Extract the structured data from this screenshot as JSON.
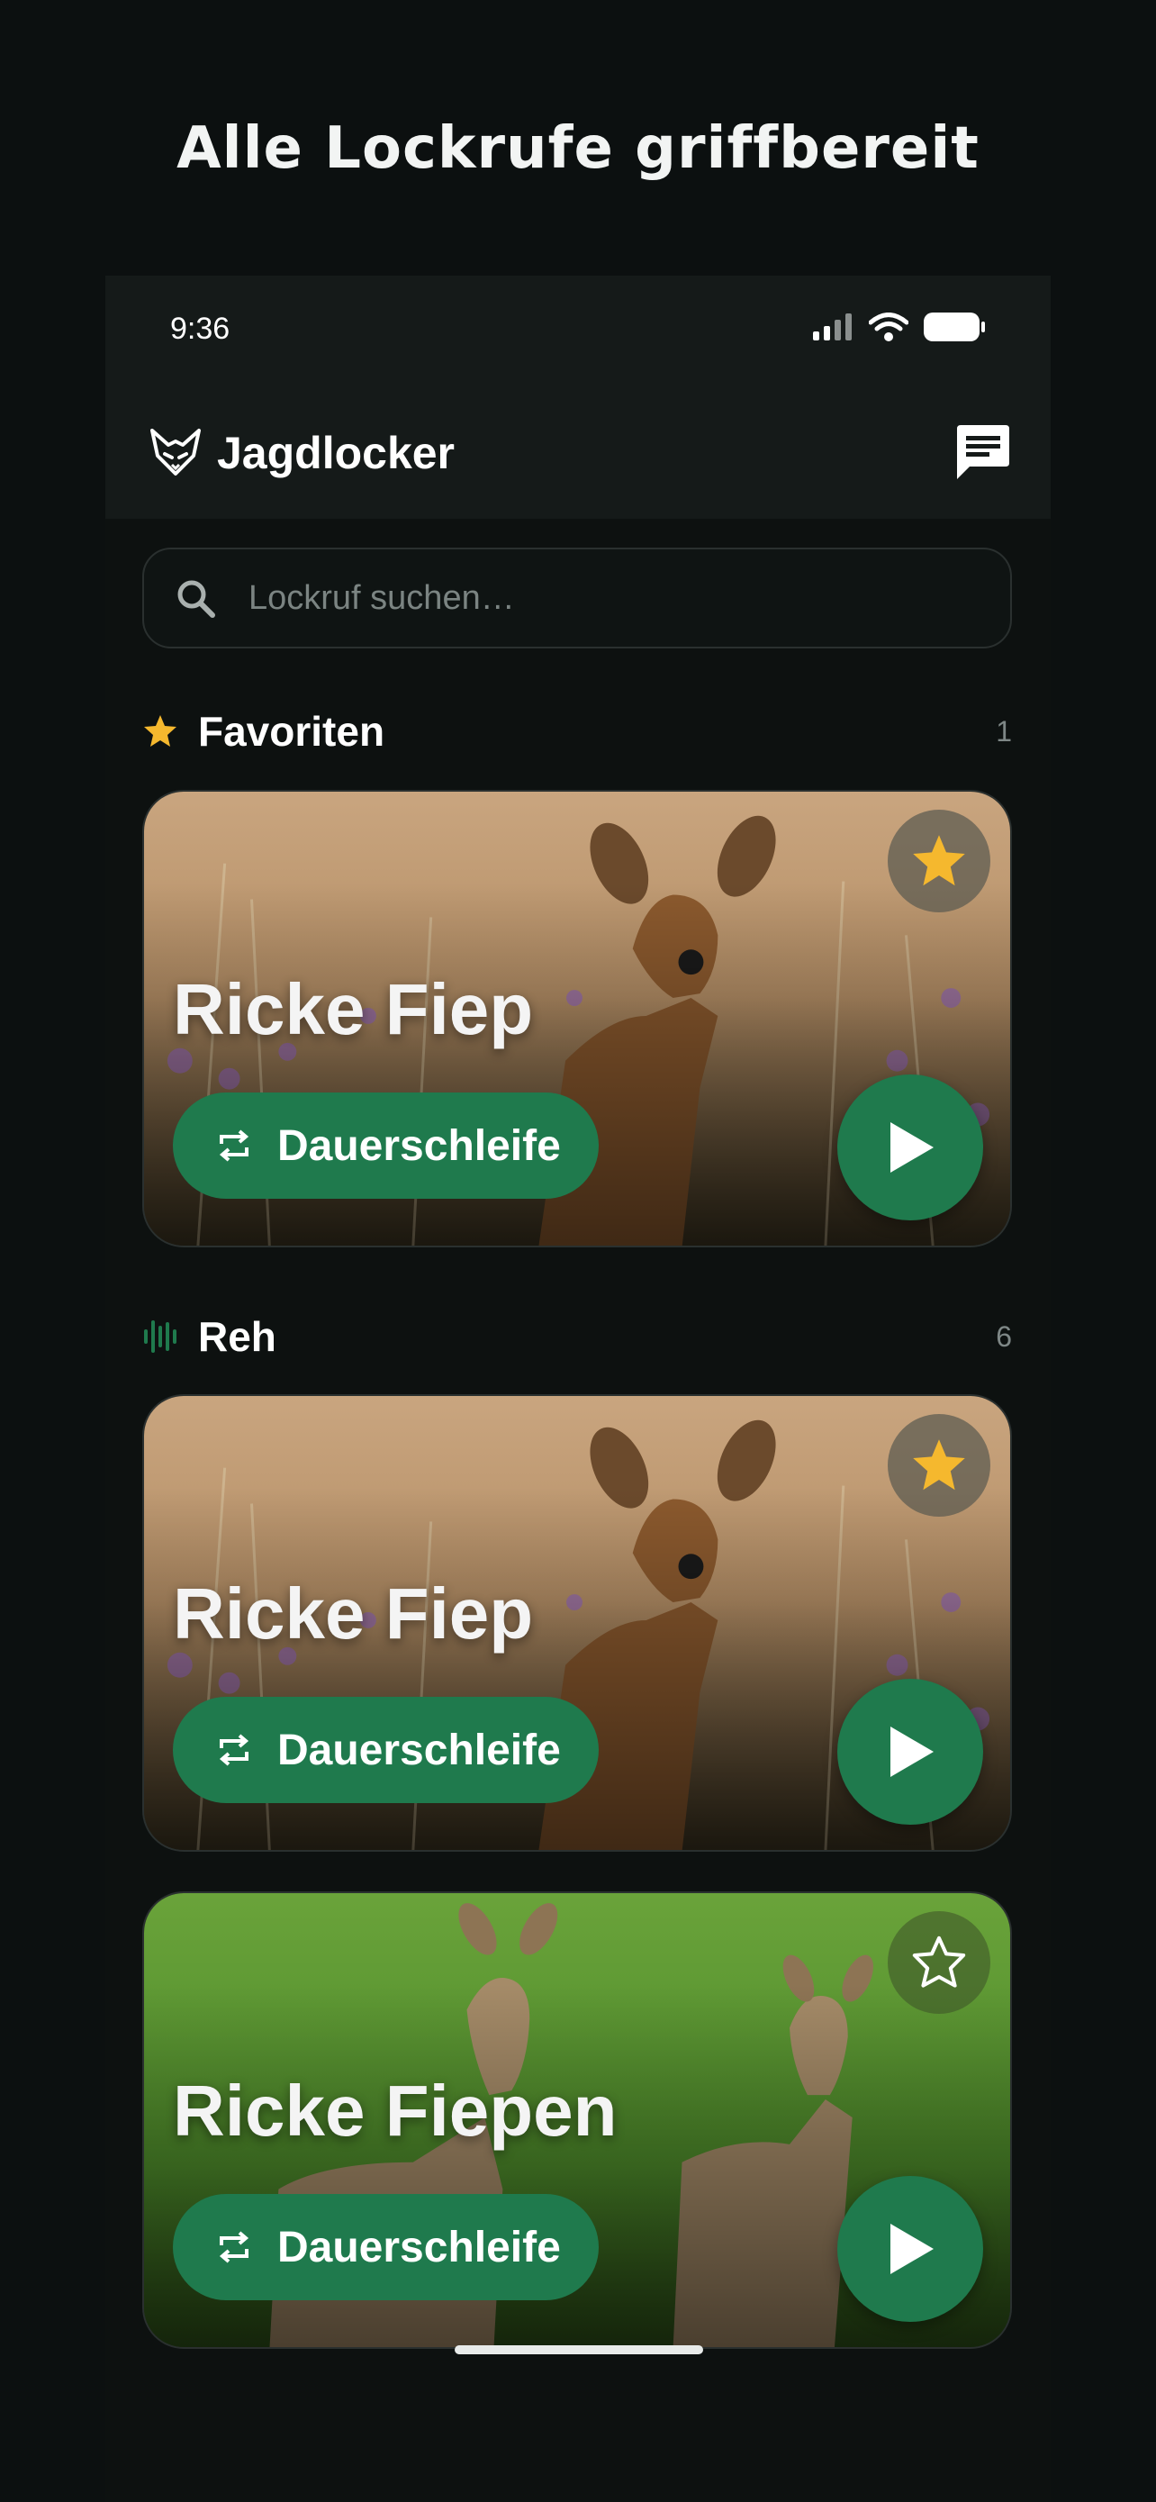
{
  "headline": "Alle Lockrufe griffbereit",
  "status_bar": {
    "time": "9:36"
  },
  "app_bar": {
    "title": "Jagdlocker",
    "logo_icon": "fox-head-icon",
    "action_icon": "chat-icon"
  },
  "search": {
    "placeholder": "Lockruf suchen…",
    "value": ""
  },
  "sections": [
    {
      "title": "Favoriten",
      "count": "1",
      "icon": "star-icon",
      "icon_color": "#f5b82e",
      "cards": [
        {
          "title": "Ricke Fiep",
          "loop_label": "Dauerschleife",
          "favorite": true,
          "image": "doe-in-meadow"
        }
      ]
    },
    {
      "title": "Reh",
      "count": "6",
      "icon": "soundwave-icon",
      "icon_color": "#1f7a4d",
      "cards": [
        {
          "title": "Ricke Fiep",
          "loop_label": "Dauerschleife",
          "favorite": true,
          "image": "doe-in-meadow"
        },
        {
          "title": "Ricke Fiepen",
          "loop_label": "Dauerschleife",
          "favorite": false,
          "image": "two-deer-on-grass"
        }
      ]
    }
  ],
  "colors": {
    "background": "#0c1010",
    "accent": "#1f7a4d",
    "star": "#f5b82e"
  }
}
